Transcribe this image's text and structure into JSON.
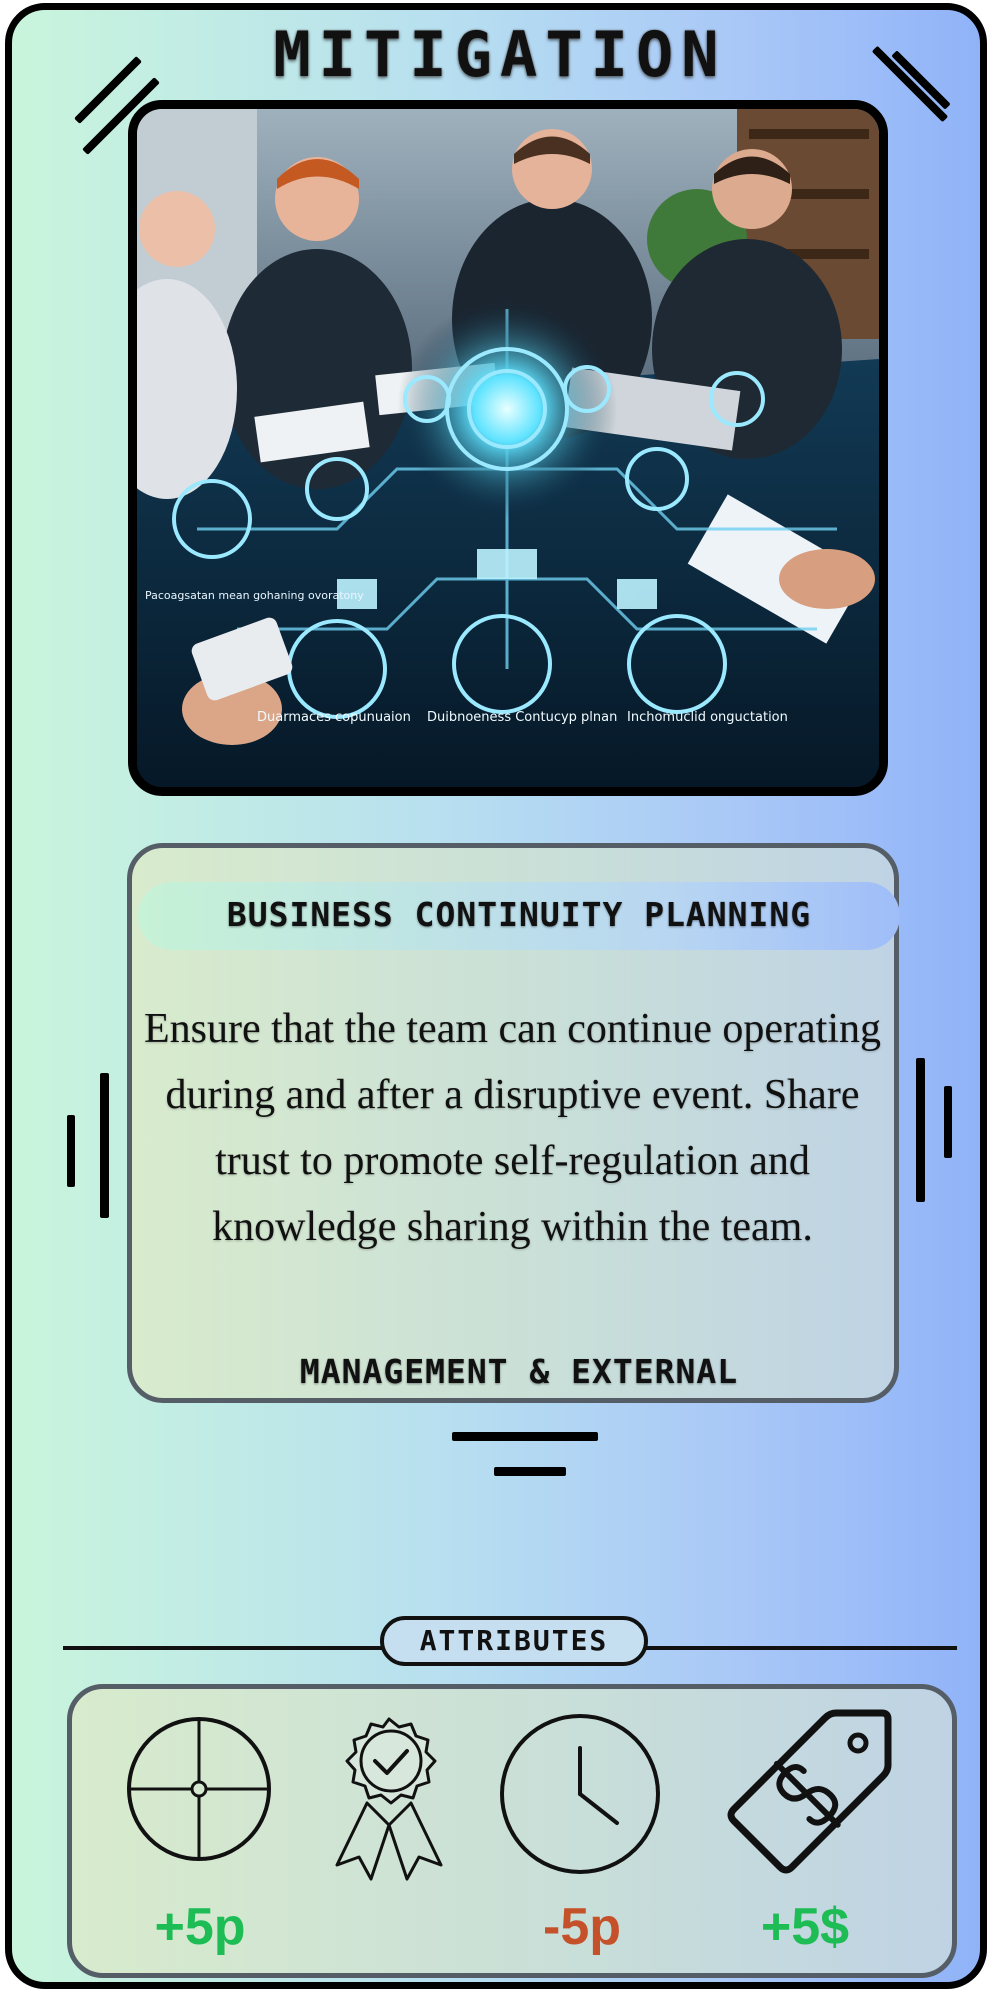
{
  "card": {
    "title": "MITIGATION",
    "subtitle": "BUSINESS CONTINUITY PLANNING",
    "description": "Ensure that the team can continue operating during and after a disruptive event. Share trust to promote self-regulation and knowledge sharing within the team.",
    "category": "MANAGEMENT & EXTERNAL",
    "image_labels": {
      "left_top": "Pacoagsatan mean gohaning ovoratony",
      "bottom_1": "Duarmaces copunuaion",
      "bottom_2": "Duibnoeness Contucyp plnan",
      "bottom_3": "Inchomuclid onguctation"
    }
  },
  "attributes": {
    "label": "ATTRIBUTES",
    "items": [
      {
        "icon": "crosshair-icon",
        "value": "+5p",
        "color": "#1ebc55"
      },
      {
        "icon": "award-ribbon-icon",
        "value": "",
        "color": "#1ebc55"
      },
      {
        "icon": "clock-icon",
        "value": "-5p",
        "color": "#c5512a"
      },
      {
        "icon": "price-tag-dollar-icon",
        "value": "+5$",
        "color": "#1ebc55"
      }
    ]
  },
  "colors": {
    "positive": "#1ebc55",
    "negative": "#c5512a",
    "gradient_start": "#c9f5dc",
    "gradient_end": "#90b3f8"
  }
}
